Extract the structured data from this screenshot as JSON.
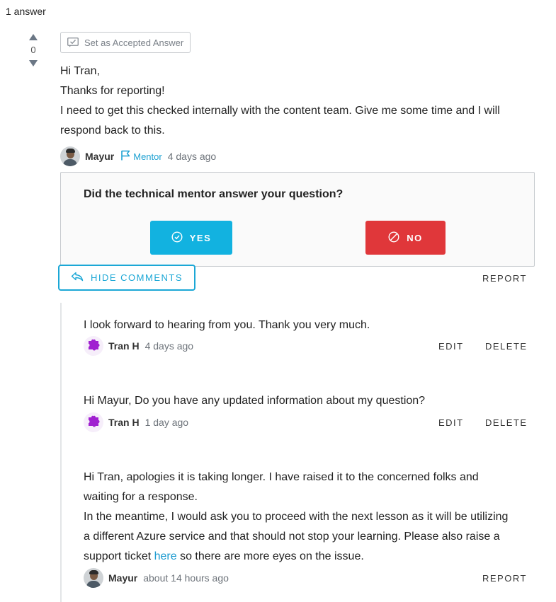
{
  "answers_count": "1 answer",
  "vote": {
    "count": "0"
  },
  "accept_button": {
    "label": "Set as Accepted Answer"
  },
  "answer": {
    "lines": [
      "Hi Tran,",
      "Thanks for reporting!",
      "I need to get this checked internally with the content team. Give me some time and I will",
      "respond back to this."
    ],
    "author": "Mayur",
    "role": "Mentor",
    "time": "4 days ago"
  },
  "mentor_prompt": {
    "question": "Did the technical mentor answer your question?",
    "yes_label": "YES",
    "no_label": "NO"
  },
  "hide_comments_label": "HIDE COMMENTS",
  "report_label": "REPORT",
  "comments": [
    {
      "text": "I look forward to hearing from you. Thank you very much.",
      "author": "Tran H",
      "time": "4 days ago",
      "edit_label": "EDIT",
      "delete_label": "DELETE"
    },
    {
      "text": "Hi Mayur, Do you have any updated information about my question?",
      "author": "Tran H",
      "time": "1 day ago",
      "edit_label": "EDIT",
      "delete_label": "DELETE"
    },
    {
      "lines": [
        "Hi Tran, apologies it is taking longer. I have raised it to the concerned folks and",
        "waiting for a response.",
        "In the meantime, I would ask you to proceed with the next lesson as it will be utilizing",
        "a different Azure service and that should not stop your learning. Please also raise a"
      ],
      "last_line_before": "support ticket ",
      "link_text": "here",
      "last_line_after": " so there are more eyes on the issue.",
      "author": "Mayur",
      "time": "about 14 hours ago",
      "report_label": "REPORT"
    }
  ],
  "colors": {
    "accent": "#12b2e0",
    "danger": "#e0373a",
    "link": "#1a9ad0",
    "puzzle": "#a020d0"
  }
}
